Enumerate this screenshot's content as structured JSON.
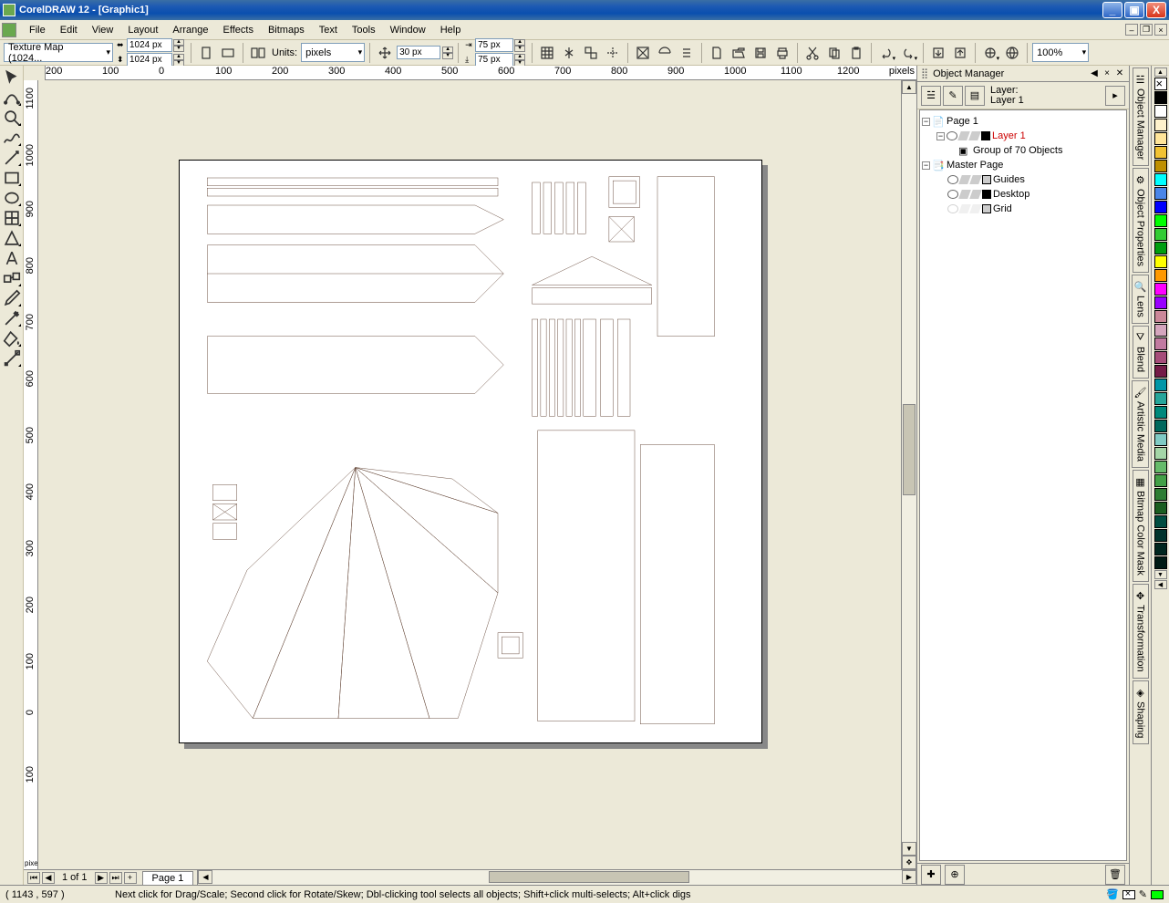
{
  "titlebar": {
    "app": "CorelDRAW 12",
    "doc": "[Graphic1]"
  },
  "menu": {
    "file": "File",
    "edit": "Edit",
    "view": "View",
    "layout": "Layout",
    "arrange": "Arrange",
    "effects": "Effects",
    "bitmaps": "Bitmaps",
    "text": "Text",
    "tools": "Tools",
    "window": "Window",
    "help": "Help"
  },
  "propbar": {
    "preset": "Texture Map (1024...",
    "width": "1024 px",
    "height": "1024 px",
    "units_label": "Units:",
    "units": "pixels",
    "nudge": "30 px",
    "dupx": "75 px",
    "dupy": "75 px",
    "zoom": "100%"
  },
  "ruler": {
    "unit": "pixels",
    "h": [
      "200",
      "100",
      "0",
      "100",
      "200",
      "300",
      "400",
      "500",
      "600",
      "700",
      "800",
      "900",
      "1000",
      "1100",
      "1200"
    ],
    "v": [
      "1100",
      "1000",
      "900",
      "800",
      "700",
      "600",
      "500",
      "400",
      "300",
      "200",
      "100",
      "0",
      "100"
    ]
  },
  "pagenav": {
    "counter": "1 of 1",
    "tab": "Page 1"
  },
  "docker": {
    "title": "Object Manager",
    "layer_label": "Layer:",
    "layer_name": "Layer 1",
    "tree": {
      "page": "Page 1",
      "layer": "Layer 1",
      "group": "Group of 70 Objects",
      "master": "Master Page",
      "guides": "Guides",
      "desktop": "Desktop",
      "grid": "Grid"
    }
  },
  "righttabs": {
    "om": "Object Manager",
    "op": "Object Properties",
    "lens": "Lens",
    "blend": "Blend",
    "am": "Artistic Media",
    "bcm": "Bitmap Color Mask",
    "tr": "Transformation",
    "sh": "Shaping"
  },
  "palette": [
    "#000000",
    "#ffffff",
    "#fff2cc",
    "#ffe599",
    "#f1c232",
    "#bf9000",
    "#00ffff",
    "#4a86e8",
    "#0000ff",
    "#00ff00",
    "#33cc33",
    "#009e0f",
    "#ffff00",
    "#ff9900",
    "#ff00ff",
    "#9900ff",
    "#cc8899",
    "#d5a6bd",
    "#c27ba0",
    "#a64d79",
    "#741b47",
    "#0097a7",
    "#26a69a",
    "#00897b",
    "#00695c",
    "#80cbc4",
    "#a5d6a7",
    "#66bb6a",
    "#43a047",
    "#2e7d32",
    "#1b5e20",
    "#004d40",
    "#00332b",
    "#00261f",
    "#001a14"
  ],
  "status": {
    "coords": "( 1143 , 597   )",
    "hint": "Next click for Drag/Scale; Second click for Rotate/Skew; Dbl-clicking tool selects all objects; Shift+click multi-selects; Alt+click digs",
    "fill": "#00ff00"
  }
}
